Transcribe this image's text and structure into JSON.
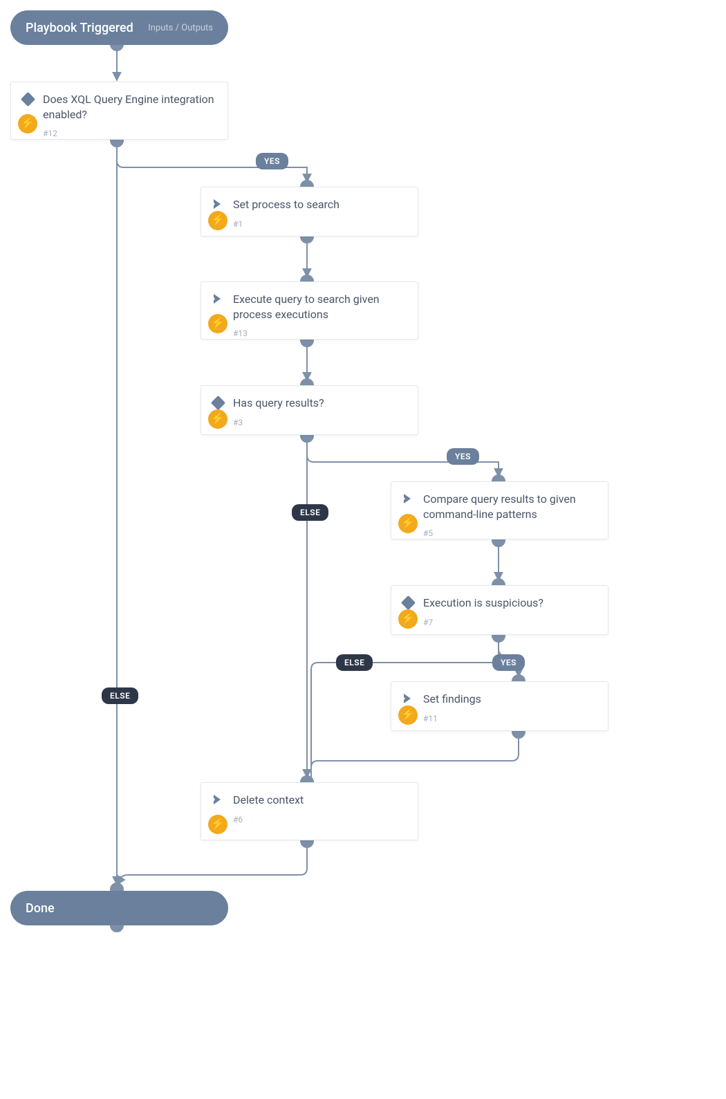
{
  "start": {
    "title": "Playbook Triggered",
    "io_link": "Inputs / Outputs"
  },
  "end": {
    "title": "Done"
  },
  "branch_labels": {
    "yes": "YES",
    "else": "ELSE"
  },
  "nodes": {
    "n12": {
      "title": "Does XQL Query Engine integration enabled?",
      "id": "#12",
      "type": "condition"
    },
    "n1": {
      "title": "Set process to search",
      "id": "#1",
      "type": "task"
    },
    "n13": {
      "title": "Execute query to search given process executions",
      "id": "#13",
      "type": "task"
    },
    "n3": {
      "title": "Has query results?",
      "id": "#3",
      "type": "condition"
    },
    "n5": {
      "title": "Compare query results to given command-line patterns",
      "id": "#5",
      "type": "task"
    },
    "n7": {
      "title": "Execution is suspicious?",
      "id": "#7",
      "type": "condition"
    },
    "n11": {
      "title": "Set findings",
      "id": "#11",
      "type": "task"
    },
    "n6": {
      "title": "Delete context",
      "id": "#6",
      "type": "task"
    }
  }
}
